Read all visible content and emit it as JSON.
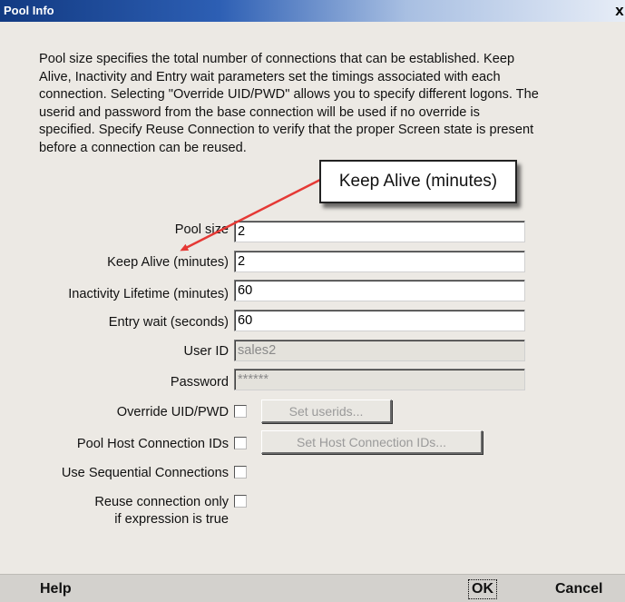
{
  "window": {
    "title": "Pool Info",
    "close_glyph": "x"
  },
  "description": "Pool size specifies the total number of connections that can be established.  Keep\nAlive, Inactivity and Entry wait parameters set the timings associated with each\nconnection.  Selecting \"Override UID/PWD\" allows you to specify different logons. The\nuserid and password from the base connection will be used if no override is\nspecified. Specify Reuse Connection to verify that the proper Screen state is present\nbefore a connection can be reused.",
  "callout": {
    "text": "Keep Alive (minutes)",
    "color": "#e53935"
  },
  "fields": {
    "pool_size": {
      "label": "Pool size",
      "value": "2"
    },
    "keep_alive": {
      "label": "Keep Alive (minutes)",
      "value": "2"
    },
    "inactivity": {
      "label": "Inactivity Lifetime (minutes)",
      "value": "60"
    },
    "entry_wait": {
      "label": "Entry wait (seconds)",
      "value": "60"
    },
    "user_id": {
      "label": "User ID",
      "value": "sales2",
      "disabled": true
    },
    "password": {
      "label": "Password",
      "value": "******",
      "disabled": true
    }
  },
  "checks": {
    "override_uid": {
      "label": "Override UID/PWD",
      "checked": false,
      "button": "Set userids..."
    },
    "pool_host_ids": {
      "label": "Pool Host Connection IDs",
      "checked": false,
      "button": "Set Host Connection IDs..."
    },
    "sequential": {
      "label": "Use Sequential Connections",
      "checked": false
    },
    "reuse": {
      "label_line1": "Reuse connection only",
      "label_line2": "if expression is true",
      "checked": false
    }
  },
  "footer": {
    "help": "Help",
    "ok": "OK",
    "cancel": "Cancel"
  },
  "colors": {
    "title_start": "#123a82",
    "dialog_bg": "#ece9e4",
    "footer_bg": "#d3d1cd"
  }
}
